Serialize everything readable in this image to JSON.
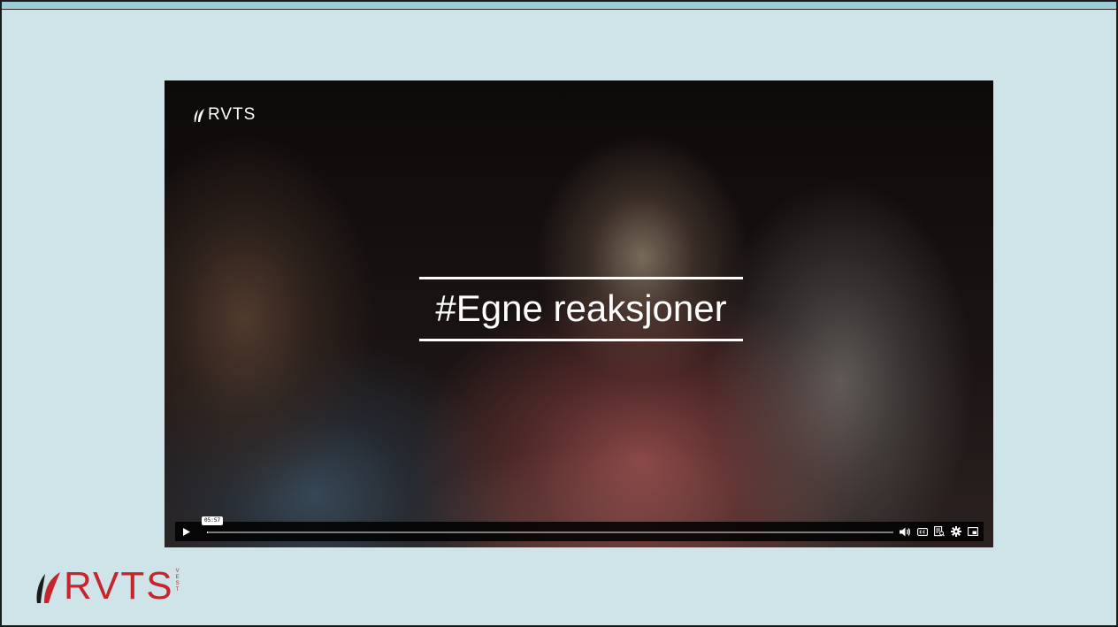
{
  "player": {
    "brand_logo_text": "RVTS",
    "title_card": "#Egne reaksjoner",
    "current_time": "05:57",
    "progress_fraction": 0.001,
    "controls": {
      "play": "play-icon",
      "volume": "volume-icon",
      "captions": "closed-captions-icon",
      "transcript": "transcript-icon",
      "settings": "gear-icon",
      "pip": "picture-in-picture-icon"
    }
  },
  "footer": {
    "logo_text": "RVTS",
    "logo_suffix": "VEST",
    "logo_color": "#c8242b"
  },
  "colors": {
    "page_background": "#cfe4e8",
    "top_strip": "#9ecdd8"
  }
}
